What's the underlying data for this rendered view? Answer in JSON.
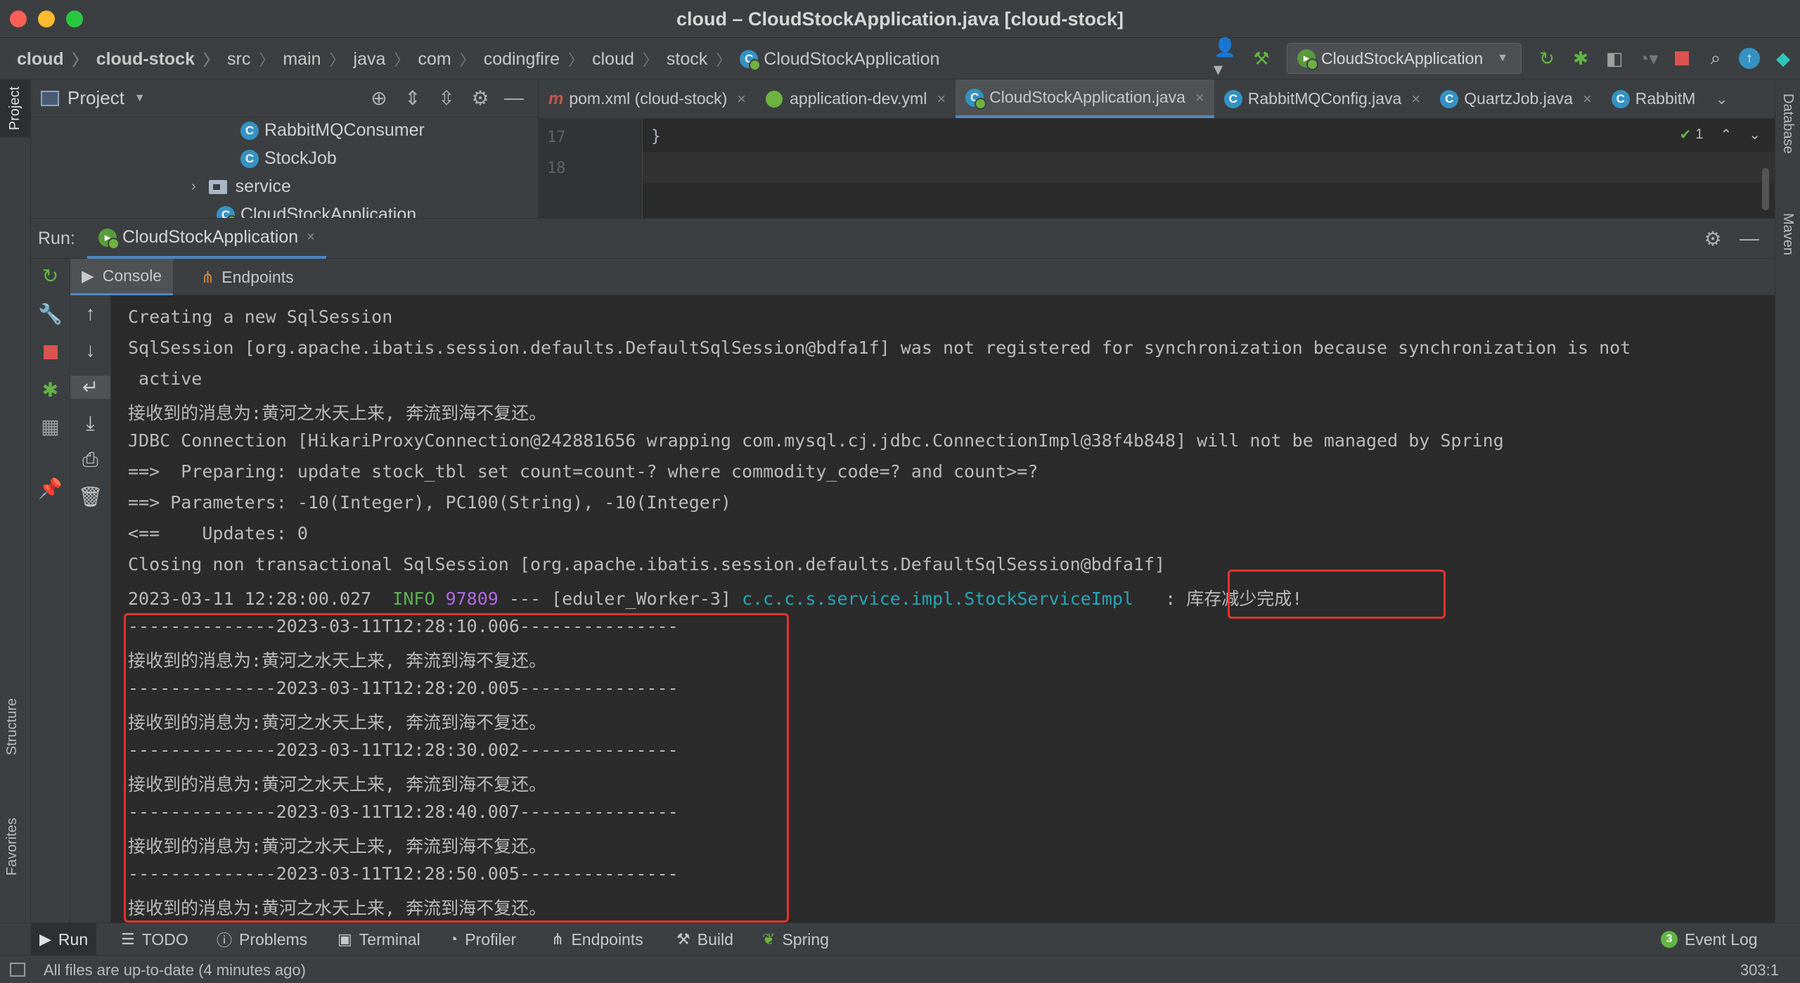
{
  "window": {
    "title": "cloud – CloudStockApplication.java [cloud-stock]"
  },
  "breadcrumb": [
    "cloud",
    "cloud-stock",
    "src",
    "main",
    "java",
    "com",
    "codingfire",
    "cloud",
    "stock",
    "CloudStockApplication"
  ],
  "toolbar": {
    "run_config": "CloudStockApplication"
  },
  "project": {
    "title": "Project",
    "tree": [
      {
        "label": "RabbitMQConsumer",
        "icon": "class-icon"
      },
      {
        "label": "StockJob",
        "icon": "class-icon"
      },
      {
        "label": "service",
        "icon": "folder-icon"
      },
      {
        "label": "CloudStockApplication",
        "icon": "spring-class-icon"
      }
    ]
  },
  "left_stripe": {
    "project": "Project",
    "structure": "Structure",
    "favorites": "Favorites"
  },
  "right_stripe": {
    "database": "Database",
    "maven": "Maven"
  },
  "editor": {
    "tabs": [
      {
        "label": "pom.xml (cloud-stock)",
        "icon": "maven-icon"
      },
      {
        "label": "application-dev.yml",
        "icon": "yml-icon"
      },
      {
        "label": "CloudStockApplication.java",
        "icon": "spring-class-icon",
        "active": true
      },
      {
        "label": "RabbitMQConfig.java",
        "icon": "class-icon"
      },
      {
        "label": "QuartzJob.java",
        "icon": "class-icon"
      },
      {
        "label": "RabbitM",
        "icon": "class-icon"
      }
    ],
    "lines": [
      {
        "no": "17",
        "code": "}"
      },
      {
        "no": "18",
        "code": ""
      }
    ],
    "inspection_count": "1"
  },
  "run": {
    "label": "Run:",
    "tab": "CloudStockApplication",
    "console_tab": "Console",
    "endpoints_tab": "Endpoints"
  },
  "console": {
    "lines": [
      "Creating a new SqlSession",
      "SqlSession [org.apache.ibatis.session.defaults.DefaultSqlSession@bdfa1f] was not registered for synchronization because synchronization is not",
      " active",
      "接收到的消息为:黄河之水天上来, 奔流到海不复还。",
      "JDBC Connection [HikariProxyConnection@242881656 wrapping com.mysql.cj.jdbc.ConnectionImpl@38f4b848] will not be managed by Spring",
      "==>  Preparing: update stock_tbl set count=count-? where commodity_code=? and count>=?",
      "==> Parameters: -10(Integer), PC100(String), -10(Integer)",
      "<==    Updates: 0",
      "Closing non transactional SqlSession [org.apache.ibatis.session.defaults.DefaultSqlSession@bdfa1f]"
    ],
    "log_line": {
      "timestamp": "2023-03-11 12:28:00.027",
      "level": "INFO",
      "pid": "97809",
      "thread": "--- [eduler_Worker-3]",
      "logger": "c.c.c.s.service.impl.StockServiceImpl",
      "message": ": 库存减少完成!"
    },
    "job_lines": [
      "--------------2023-03-11T12:28:10.006---------------",
      "接收到的消息为:黄河之水天上来, 奔流到海不复还。",
      "--------------2023-03-11T12:28:20.005---------------",
      "接收到的消息为:黄河之水天上来, 奔流到海不复还。",
      "--------------2023-03-11T12:28:30.002---------------",
      "接收到的消息为:黄河之水天上来, 奔流到海不复还。",
      "--------------2023-03-11T12:28:40.007---------------",
      "接收到的消息为:黄河之水天上来, 奔流到海不复还。",
      "--------------2023-03-11T12:28:50.005---------------",
      "接收到的消息为:黄河之水天上来, 奔流到海不复还。"
    ]
  },
  "bottom_tools": {
    "run": "Run",
    "todo": "TODO",
    "problems": "Problems",
    "terminal": "Terminal",
    "profiler": "Profiler",
    "endpoints": "Endpoints",
    "build": "Build",
    "spring": "Spring",
    "event_log": "Event Log",
    "event_count": "3"
  },
  "status": {
    "text": "All files are up-to-date (4 minutes ago)",
    "position": "303:1"
  },
  "colors": {
    "accent": "#4a88c7",
    "highlight_box": "#e5322d",
    "info": "#5fae55",
    "pid": "#b267e6",
    "logger": "#27a6b8"
  }
}
